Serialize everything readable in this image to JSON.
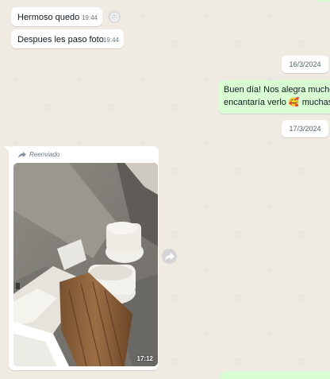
{
  "messages": [
    {
      "text": "Hermoso quedo",
      "time": "19:44"
    },
    {
      "text": "Despues les paso foto",
      "time": "19:44"
    }
  ],
  "dates": [
    "16/3/2024",
    "17/3/2024"
  ],
  "outgoing": {
    "line1": "Buen día! Nos alegra mucho",
    "line2": "encantaría verlo 🥰 muchas"
  },
  "forwarded": {
    "label": "Reenviado",
    "time": "17:12"
  },
  "icons": {
    "react": "emoji-react-icon",
    "forward": "forward-icon",
    "forwarded": "forwarded-arrow-icon"
  },
  "colors": {
    "chat_bg": "#efeae2",
    "incoming": "#ffffff",
    "outgoing": "#d9fdd3",
    "meta": "#667781"
  }
}
